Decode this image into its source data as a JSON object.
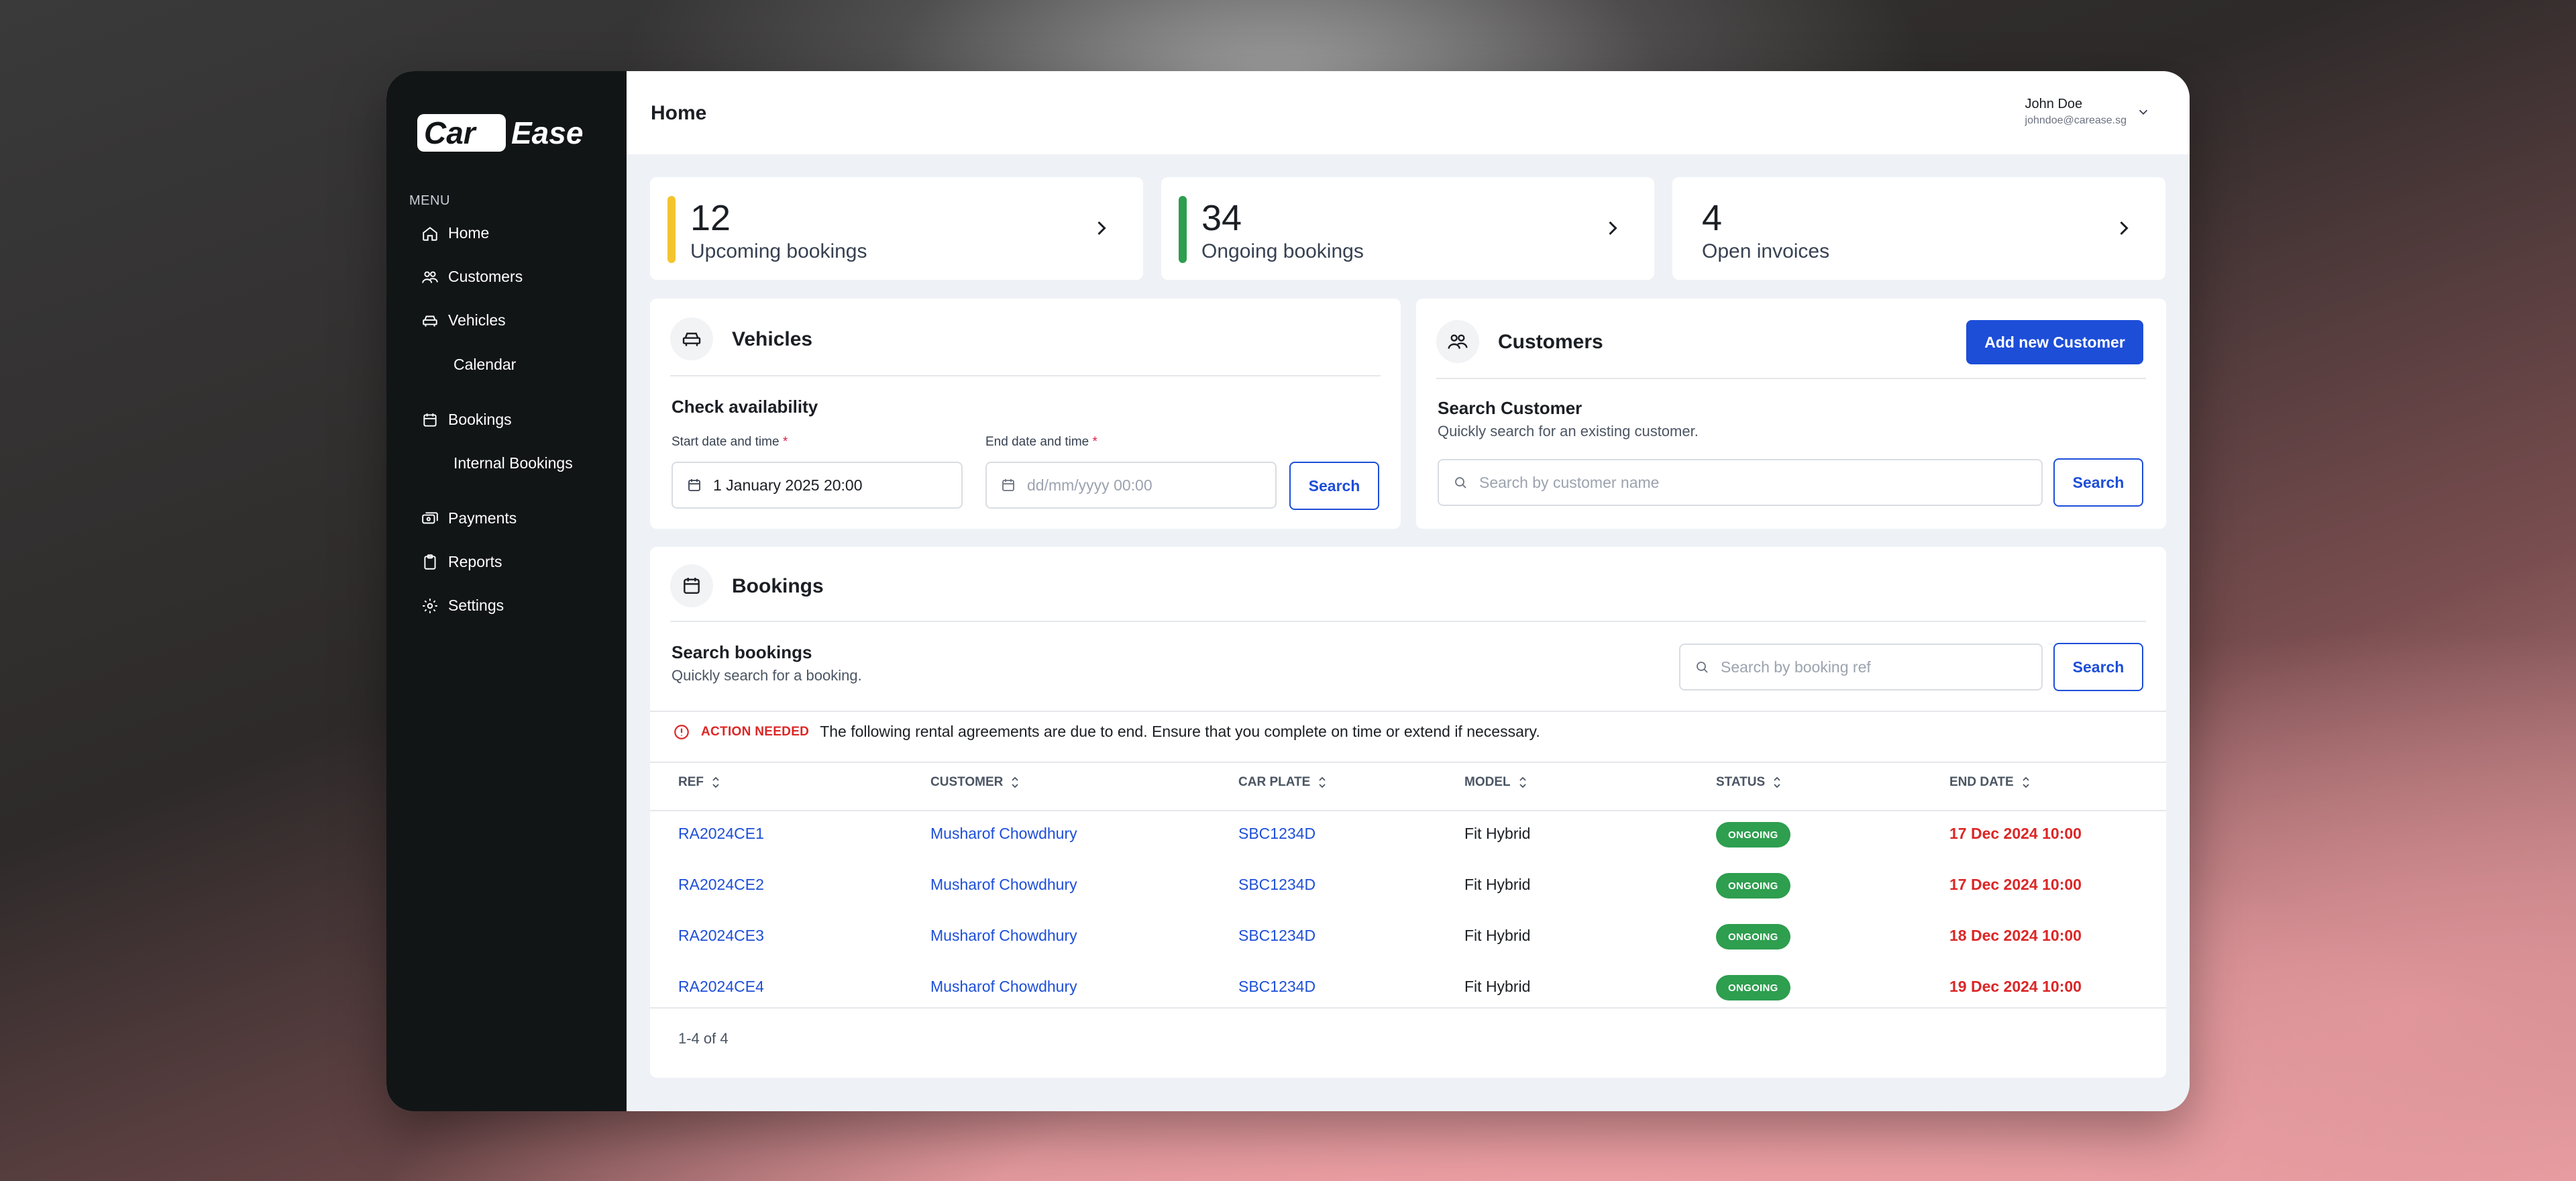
{
  "brand": {
    "logo_part1": "Car",
    "logo_part2": "Ease"
  },
  "sidebar": {
    "menu_heading": "MENU",
    "items": [
      {
        "label": "Home",
        "icon": "home-icon"
      },
      {
        "label": "Customers",
        "icon": "users-icon"
      },
      {
        "label": "Vehicles",
        "icon": "car-icon"
      },
      {
        "label": "Calendar",
        "icon": ""
      },
      {
        "label": "Bookings",
        "icon": "calendar-icon"
      },
      {
        "label": "Internal Bookings",
        "icon": ""
      },
      {
        "label": "Payments",
        "icon": "payments-icon"
      },
      {
        "label": "Reports",
        "icon": "clipboard-icon"
      },
      {
        "label": "Settings",
        "icon": "gear-icon"
      }
    ]
  },
  "header": {
    "title": "Home",
    "user_name": "John Doe",
    "user_email": "johndoe@carease.sg"
  },
  "stats": [
    {
      "value": "12",
      "label": "Upcoming bookings",
      "color": "#f4c430"
    },
    {
      "value": "34",
      "label": "Ongoing bookings",
      "color": "#2e9e4f"
    },
    {
      "value": "4",
      "label": "Open invoices",
      "color": ""
    }
  ],
  "vehicles": {
    "title": "Vehicles",
    "subhead": "Check availability",
    "start_label": "Start date and time",
    "start_value": "1 January 2025 20:00",
    "end_label": "End date and time",
    "end_placeholder": "dd/mm/yyyy 00:00",
    "required_mark": "*",
    "search_label": "Search"
  },
  "customers": {
    "title": "Customers",
    "add_label": "Add new Customer",
    "subhead": "Search Customer",
    "subtext": "Quickly search for an existing customer.",
    "search_placeholder": "Search by customer name",
    "search_label": "Search"
  },
  "bookings": {
    "title": "Bookings",
    "subhead": "Search bookings",
    "subtext": "Quickly search for a booking.",
    "search_placeholder": "Search by booking ref",
    "search_label": "Search",
    "alert_tag": "ACTION NEEDED",
    "alert_text": "The following rental agreements are due to end. Ensure that you complete on time or extend if necessary.",
    "columns": [
      "REF",
      "CUSTOMER",
      "CAR PLATE",
      "MODEL",
      "STATUS",
      "END DATE"
    ],
    "rows": [
      {
        "ref": "RA2024CE1",
        "customer": "Musharof Chowdhury",
        "plate": "SBC1234D",
        "model": "Fit Hybrid",
        "status": "ONGOING",
        "end": "17 Dec 2024 10:00"
      },
      {
        "ref": "RA2024CE2",
        "customer": "Musharof Chowdhury",
        "plate": "SBC1234D",
        "model": "Fit Hybrid",
        "status": "ONGOING",
        "end": "17 Dec 2024 10:00"
      },
      {
        "ref": "RA2024CE3",
        "customer": "Musharof Chowdhury",
        "plate": "SBC1234D",
        "model": "Fit Hybrid",
        "status": "ONGOING",
        "end": "18 Dec 2024 10:00"
      },
      {
        "ref": "RA2024CE4",
        "customer": "Musharof Chowdhury",
        "plate": "SBC1234D",
        "model": "Fit Hybrid",
        "status": "ONGOING",
        "end": "19 Dec 2024 10:00"
      }
    ],
    "pagination": "1-4 of 4"
  },
  "colors": {
    "accent": "#1d4ed8",
    "sidebar_bg": "#121516",
    "status_green": "#2e9e4f",
    "alert_red": "#dc2626"
  }
}
